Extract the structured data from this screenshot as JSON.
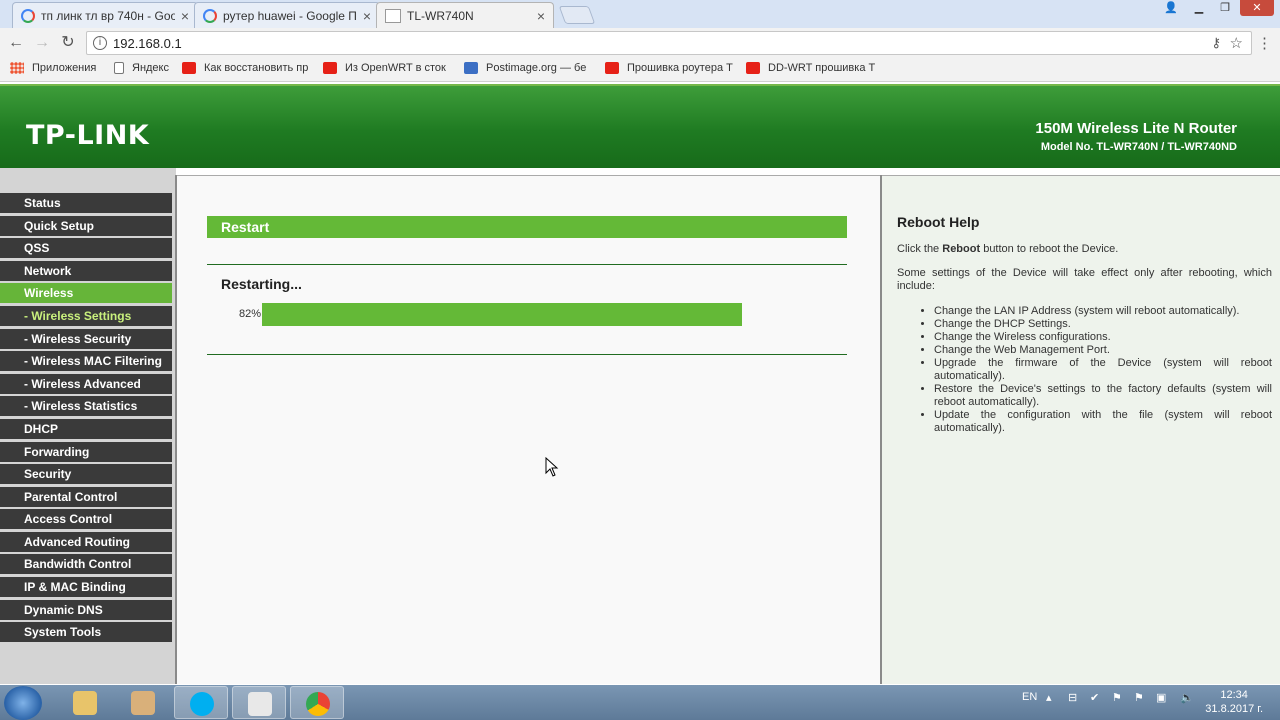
{
  "browser": {
    "tabs": [
      {
        "title": "тп линк тл вр 740н - Goo"
      },
      {
        "title": "рутер huawei - Google П"
      },
      {
        "title": "TL-WR740N"
      }
    ],
    "url": "192.168.0.1",
    "bookmarks": [
      {
        "label": "Приложения",
        "icon": "apps-icon"
      },
      {
        "label": "Яндекс",
        "icon": "page-icon"
      },
      {
        "label": "Как восстановить пр",
        "icon": "youtube-icon"
      },
      {
        "label": "Из OpenWRT в сток",
        "icon": "youtube-icon"
      },
      {
        "label": "Postimage.org — бе",
        "icon": "postimage-icon"
      },
      {
        "label": "Прошивка роутера Т",
        "icon": "youtube-icon"
      },
      {
        "label": "DD-WRT прошивка Т",
        "icon": "youtube-icon"
      }
    ]
  },
  "router": {
    "logo": "TP-LINK",
    "product": "150M Wireless Lite N Router",
    "model": "Model No. TL-WR740N / TL-WR740ND"
  },
  "menu": [
    {
      "label": "Status"
    },
    {
      "label": "Quick Setup"
    },
    {
      "label": "QSS"
    },
    {
      "label": "Network"
    },
    {
      "label": "Wireless"
    },
    {
      "label": "- Wireless Settings"
    },
    {
      "label": "- Wireless Security"
    },
    {
      "label": "- Wireless MAC Filtering"
    },
    {
      "label": "- Wireless Advanced"
    },
    {
      "label": "- Wireless Statistics"
    },
    {
      "label": "DHCP"
    },
    {
      "label": "Forwarding"
    },
    {
      "label": "Security"
    },
    {
      "label": "Parental Control"
    },
    {
      "label": "Access Control"
    },
    {
      "label": "Advanced Routing"
    },
    {
      "label": "Bandwidth Control"
    },
    {
      "label": "IP & MAC Binding"
    },
    {
      "label": "Dynamic DNS"
    },
    {
      "label": "System Tools"
    }
  ],
  "main": {
    "section_title": "Restart",
    "status": "Restarting...",
    "progress_label": "82%",
    "progress_value": 0.82
  },
  "help": {
    "title": "Reboot Help",
    "intro_before": "Click the ",
    "intro_bold": "Reboot",
    "intro_after": " button to reboot the Device.",
    "note": "Some settings of the Device will take effect only after rebooting, which include:",
    "items": [
      "Change the LAN IP Address (system will reboot automatically).",
      "Change the DHCP Settings.",
      "Change the Wireless configurations.",
      "Change the Web Management Port.",
      "Upgrade the firmware of the Device (system will reboot automatically).",
      "Restore the Device's settings to the factory defaults (system will reboot automatically).",
      "Update the configuration with the file (system will reboot automatically)."
    ]
  },
  "taskbar": {
    "lang": "EN",
    "time": "12:34",
    "date": "31.8.2017 г."
  },
  "colors": {
    "accent_green": "#64b937",
    "banner_green": "#1f7b22",
    "menu_dark": "#3a3a3a"
  }
}
